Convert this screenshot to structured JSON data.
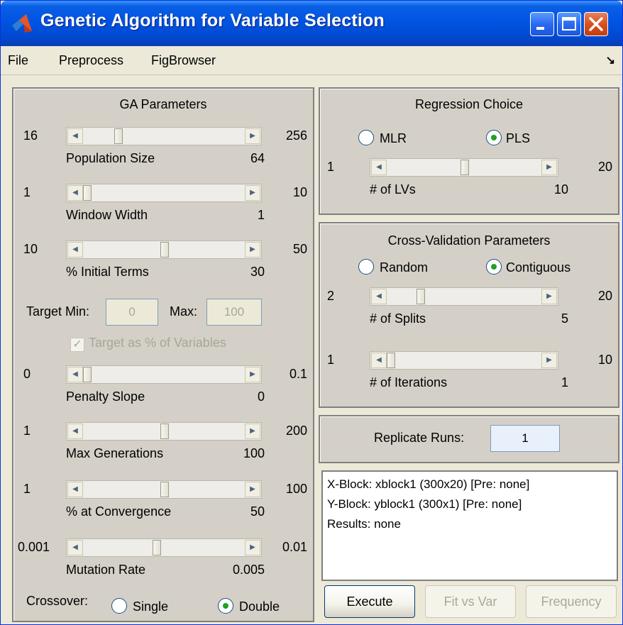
{
  "window": {
    "title": "Genetic Algorithm for Variable Selection"
  },
  "menu": {
    "items": [
      "File",
      "Preprocess",
      "FigBrowser"
    ],
    "corner_icon": "dock-arrow-icon"
  },
  "ga": {
    "title": "GA Parameters",
    "sliders": [
      {
        "min": "16",
        "max": "256",
        "label": "Population Size",
        "value": "64",
        "thumb_fraction": 0.2
      },
      {
        "min": "1",
        "max": "10",
        "label": "Window Width",
        "value": "1",
        "thumb_fraction": 0.0
      },
      {
        "min": "10",
        "max": "50",
        "label": "% Initial Terms",
        "value": "30",
        "thumb_fraction": 0.5
      },
      {
        "min": "0",
        "max": "0.1",
        "label": "Penalty Slope",
        "value": "0",
        "thumb_fraction": 0.0
      },
      {
        "min": "1",
        "max": "200",
        "label": "Max Generations",
        "value": "100",
        "thumb_fraction": 0.5
      },
      {
        "min": "1",
        "max": "100",
        "label": "% at Convergence",
        "value": "50",
        "thumb_fraction": 0.5
      },
      {
        "min": "0.001",
        "max": "0.01",
        "label": "Mutation Rate",
        "value": "0.005",
        "thumb_fraction": 0.45
      }
    ],
    "target_min_label": "Target Min:",
    "target_min_value": "0",
    "target_max_label": "Max:",
    "target_max_value": "100",
    "target_pct_label": "Target as % of Variables",
    "crossover_label": "Crossover:",
    "crossover_single": "Single",
    "crossover_double": "Double"
  },
  "regression": {
    "title": "Regression Choice",
    "mlr": "MLR",
    "pls": "PLS",
    "slider": {
      "min": "1",
      "max": "20",
      "label": "# of LVs",
      "value": "10",
      "thumb_fraction": 0.5
    }
  },
  "cv": {
    "title": "Cross-Validation Parameters",
    "random": "Random",
    "contiguous": "Contiguous",
    "splits": {
      "min": "2",
      "max": "20",
      "label": "# of Splits",
      "value": "5",
      "thumb_fraction": 0.2
    },
    "iterations": {
      "min": "1",
      "max": "10",
      "label": "# of Iterations",
      "value": "1",
      "thumb_fraction": 0.0
    }
  },
  "replicate": {
    "label": "Replicate Runs:",
    "value": "1"
  },
  "info": {
    "lines": [
      "X-Block: xblock1 (300x20) [Pre: none]",
      "Y-Block: yblock1 (300x1) [Pre: none]",
      "Results: none"
    ]
  },
  "buttons": {
    "execute": "Execute",
    "fit_vs_var": "Fit vs Var",
    "frequency": "Frequency"
  }
}
